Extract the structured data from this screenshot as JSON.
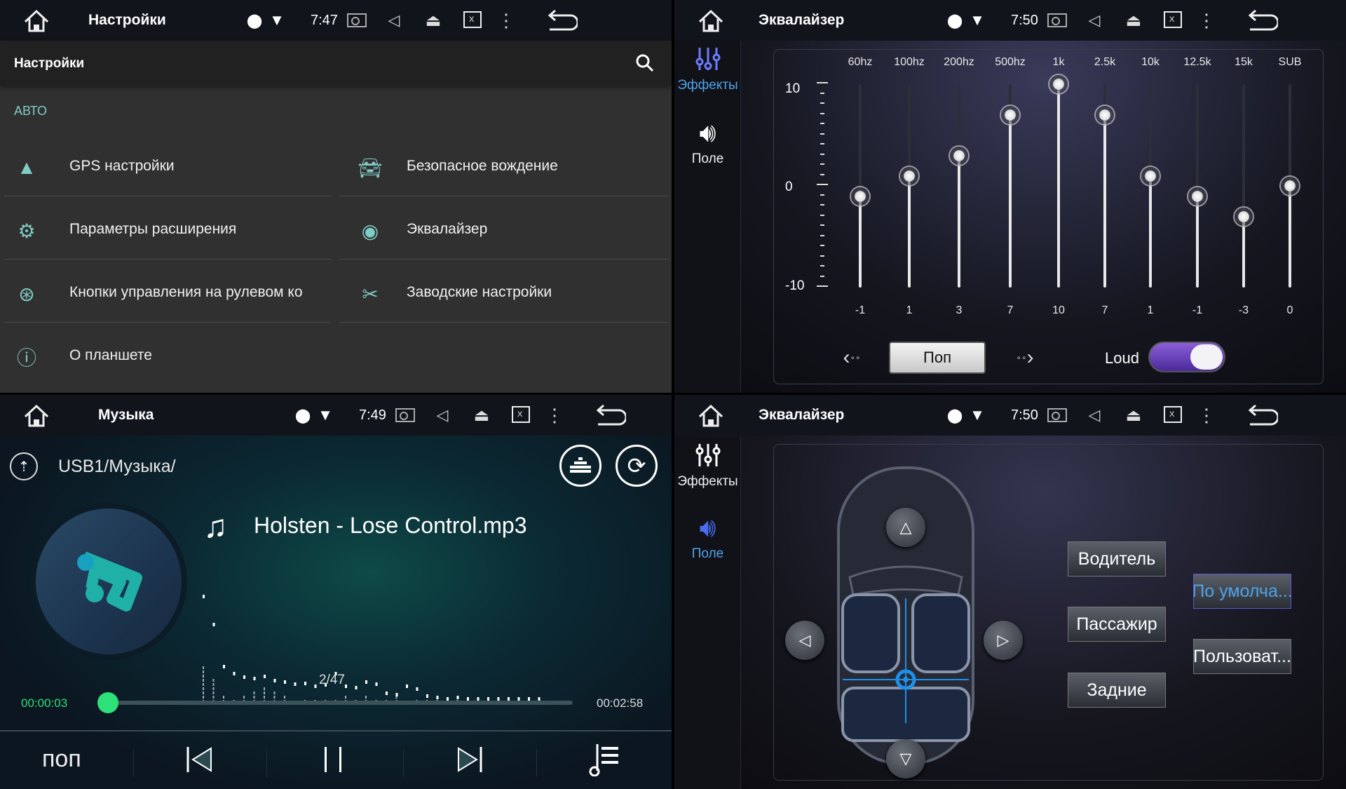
{
  "settings": {
    "status": {
      "title": "Настройки",
      "time": "7:47"
    },
    "appbar_title": "Настройки",
    "section": "АВТО",
    "items": [
      {
        "label": "GPS настройки",
        "icon": "navigation-arrow-icon"
      },
      {
        "label": "Безопасное вождение",
        "icon": "car-icon"
      },
      {
        "label": "Параметры расширения",
        "icon": "gear-icon"
      },
      {
        "label": "Эквалайзер",
        "icon": "equalizer-disc-icon"
      },
      {
        "label": "Кнопки управления на рулевом ко",
        "icon": "steering-wheel-icon"
      },
      {
        "label": "Заводские настройки",
        "icon": "tools-icon"
      },
      {
        "label": "О планшете",
        "icon": "info-icon"
      }
    ],
    "accent": "#80cbc4"
  },
  "eq": {
    "status": {
      "title": "Эквалайзер",
      "time": "7:50"
    },
    "side": {
      "effects": "Эффекты",
      "field": "Поле"
    },
    "preset": "Поп",
    "loud_label": "Loud",
    "loud_on": true,
    "scale": {
      "max": "10",
      "mid": "0",
      "min": "-10"
    },
    "chart_data": {
      "type": "slider-bars",
      "ylim": [
        -10,
        10
      ],
      "categories": [
        "60hz",
        "100hz",
        "200hz",
        "500hz",
        "1k",
        "2.5k",
        "10k",
        "12.5k",
        "15k",
        "SUB"
      ],
      "values": [
        -1,
        1,
        3,
        7,
        10,
        7,
        1,
        -1,
        -3,
        0
      ]
    },
    "toggle_color": "#6a3fb5"
  },
  "music": {
    "status": {
      "title": "Музыка",
      "time": "7:49"
    },
    "path": "USB1/Музыка/",
    "track": "Holsten - Lose Control.mp3",
    "counter": "2/47",
    "elapsed": "00:00:03",
    "total": "00:02:58",
    "progress": 0.017,
    "eq_mode": "поп",
    "accent": "#2ee07a"
  },
  "field": {
    "status": {
      "title": "Эквалайзер",
      "time": "7:50"
    },
    "side": {
      "effects": "Эффекты",
      "field": "Поле"
    },
    "buttons": {
      "driver": "Водитель",
      "passenger": "Пассажир",
      "rear": "Задние",
      "default": "По умолча...",
      "user": "Пользоват..."
    },
    "accent": "#1e90e8"
  }
}
